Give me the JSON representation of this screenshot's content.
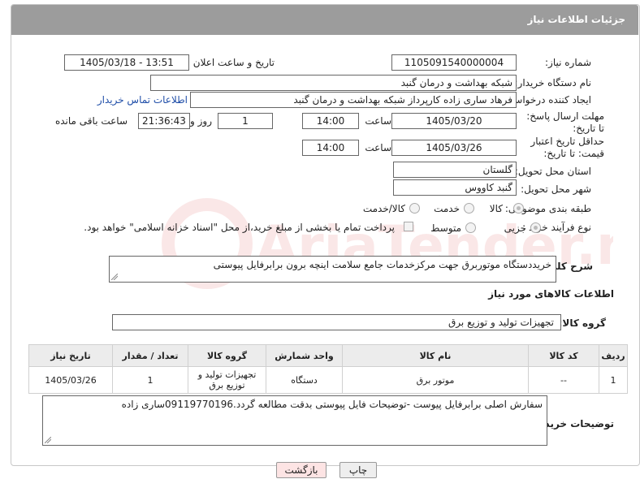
{
  "header": {
    "title": "جزئیات اطلاعات نیاز"
  },
  "fields": {
    "need_number_label": "شماره نیاز:",
    "need_number": "1105091540000004",
    "announce_label": "تاریخ و ساعت اعلان عمومی:",
    "announce_value": "1405/03/18 - 13:51",
    "buyer_label": "نام دستگاه خریدار:",
    "buyer_value": "شبکه بهداشت و درمان گنبد",
    "creator_label": "ایجاد کننده درخواست:",
    "creator_value": "فرهاد ساری زاده کارپرداز شبکه بهداشت و درمان گنبد",
    "contact_link": "اطلاعات تماس خریدار",
    "deadline_label": "مهلت ارسال پاسخ: تا تاریخ:",
    "deadline_date": "1405/03/20",
    "time_label": "ساعت",
    "deadline_time": "14:00",
    "days_value": "1",
    "days_label": "روز و",
    "remaining_time": "21:36:43",
    "remaining_label": "ساعت باقی مانده",
    "validity_label": "حداقل تاریخ اعتبار قیمت: تا تاریخ:",
    "validity_date": "1405/03/26",
    "validity_time": "14:00",
    "province_label": "استان محل تحویل:",
    "province_value": "گلستان",
    "city_label": "شهر محل تحویل:",
    "city_value": "گنبد کاووس",
    "category_label": "طبقه بندی موضوعی:",
    "category_options": [
      "کالا",
      "خدمت",
      "کالا/خدمت"
    ],
    "process_label": "نوع فرآیند خرید :",
    "process_options": [
      "جزیی",
      "متوسط"
    ],
    "payment_note": "پرداخت تمام یا بخشی از مبلغ خرید،از محل \"اسناد خزانه اسلامی\" خواهد بود.",
    "description_label": "شرح کلی نیاز:",
    "description_value": "خریددستگاه موتوربرق جهت مرکزخدمات جامع سلامت اینچه برون برابرفایل پیوستی",
    "goods_info_heading": "اطلاعات کالاهای مورد نیاز",
    "goods_group_label": "گروه کالا:",
    "goods_group_value": "تجهیزات تولید و توزیع برق"
  },
  "table": {
    "headers": [
      "ردیف",
      "کد کالا",
      "نام کالا",
      "واحد شمارش",
      "گروه کالا",
      "تعداد / مقدار",
      "تاریخ نیاز"
    ],
    "rows": [
      [
        "1",
        "--",
        "موتور برق",
        "دستگاه",
        "تجهیزات تولید و توزیع برق",
        "1",
        "1405/03/26"
      ]
    ]
  },
  "buyer_notes": {
    "label": "توضیحات خریدار:",
    "value": "سفارش اصلی برابرفایل پیوست -توضیحات فایل پیوستی بدقت مطالعه گردد.09119770196ساری زاده"
  },
  "buttons": {
    "print": "چاپ",
    "back": "بازگشت"
  },
  "watermark": {
    "text": "AriaTender.neT"
  },
  "colors": {
    "titlebar": "#9c9c9c",
    "link": "#1f4ea8",
    "back_button": "#fde4e4",
    "print_button": "#eeeeee"
  }
}
